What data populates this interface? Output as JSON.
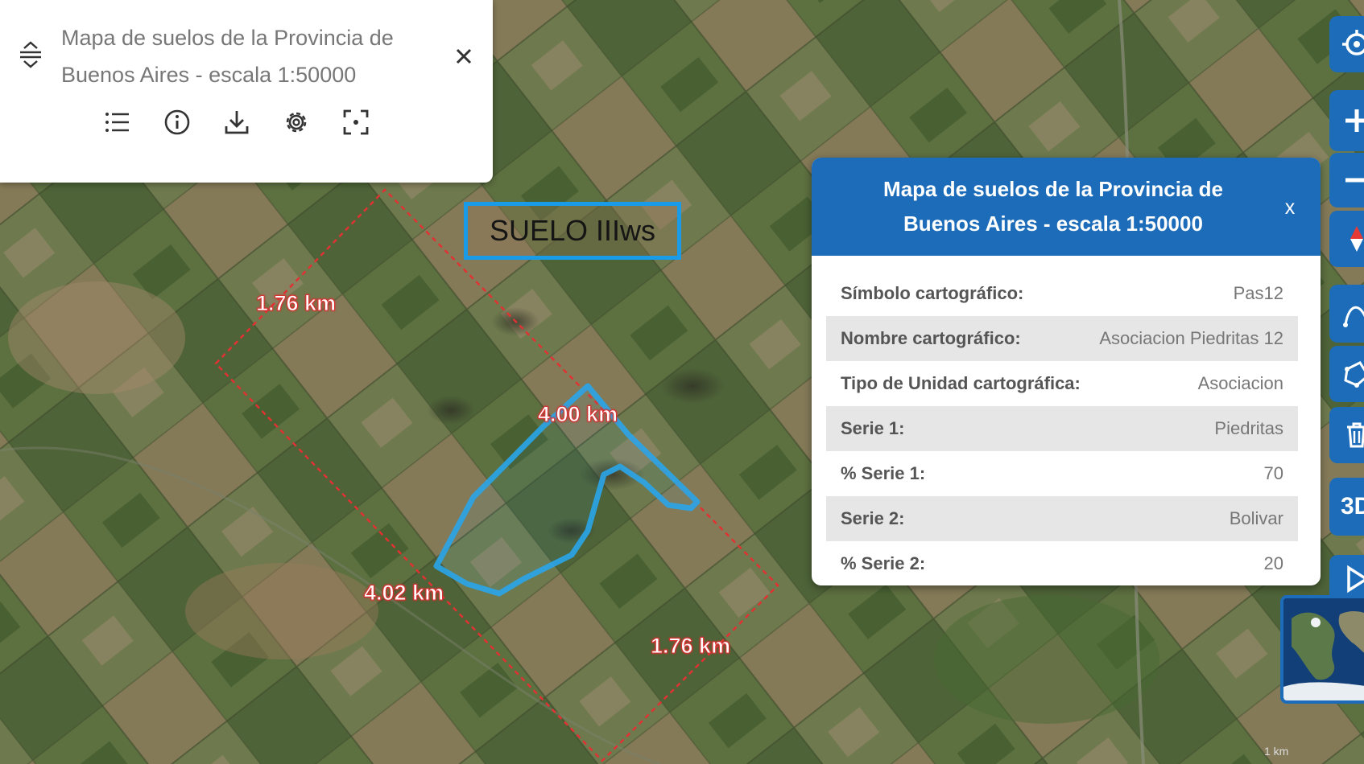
{
  "layer_panel": {
    "title": "Mapa de suelos de la Provincia de Buenos Aires - escala 1:50000",
    "tools": [
      {
        "name": "legend-list-icon"
      },
      {
        "name": "info-icon"
      },
      {
        "name": "download-icon"
      },
      {
        "name": "settings-gear-icon"
      },
      {
        "name": "zoom-to-extent-icon"
      }
    ]
  },
  "map": {
    "soil_label": "SUELO IIIws",
    "measurements": [
      "1.76 km",
      "4.00 km",
      "4.02 km",
      "1.76 km"
    ],
    "scale_text": "1 km"
  },
  "popup": {
    "title": "Mapa de suelos de la Provincia de Buenos Aires - escala 1:50000",
    "close_label": "x",
    "attributes": [
      {
        "key": "Símbolo cartográfico:",
        "value": "Pas12"
      },
      {
        "key": "Nombre cartográfico:",
        "value": "Asociacion Piedritas 12"
      },
      {
        "key": "Tipo de Unidad cartográfica:",
        "value": "Asociacion"
      },
      {
        "key": "Serie 1:",
        "value": "Piedritas"
      },
      {
        "key": "% Serie 1:",
        "value": "70"
      },
      {
        "key": "Serie 2:",
        "value": "Bolivar"
      },
      {
        "key": "% Serie 2:",
        "value": "20"
      }
    ]
  },
  "toolbar_right": {
    "buttons": [
      "locate-icon",
      "zoom-in-icon",
      "zoom-out-icon",
      "compass-icon",
      "measure-line-icon",
      "measure-area-icon",
      "trash-icon",
      "3d-button",
      "play-icon"
    ],
    "3d_label": "3D"
  },
  "colors": {
    "accent": "#1c6cb9",
    "measure_line": "#e03232",
    "polygon": "#2aa6ea"
  }
}
